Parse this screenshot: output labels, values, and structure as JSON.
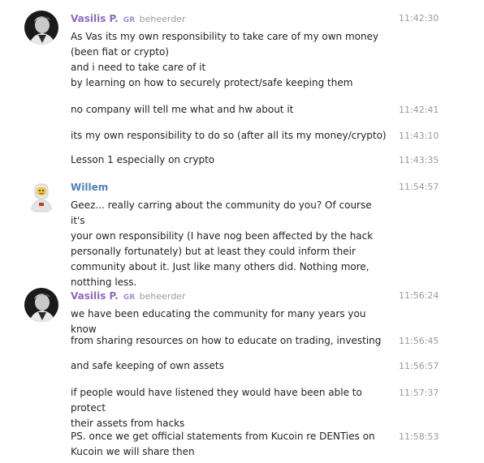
{
  "messages": [
    {
      "sender": "Vasilis P.",
      "tag": "GR",
      "role": "beheerder",
      "lines": [
        {
          "text": "As Vas its my own responsibility to take care of my own money\n(been fiat or crypto)\nand i need to take care of it\nby learning on how to securely protect/safe keeping them",
          "time": "11:42:30"
        },
        {
          "text": "no company will tell me what and hw about it",
          "time": "11:42:41"
        },
        {
          "text": "its my own responsibility to do so (after all its my money/crypto)",
          "time": "11:43:10"
        },
        {
          "text": "Lesson 1 especially on crypto",
          "time": "11:43:35"
        }
      ]
    },
    {
      "sender": "Willem",
      "lines": [
        {
          "text": "Geez... really carring about the community do you? Of course it's\nyour own responsibility (I have nog been affected by the hack\npersonally fortunately) but at least they could inform their\ncommunity about it. Just like many others did. Nothing more,\nnotthing less.",
          "time": "11:54:57"
        }
      ]
    },
    {
      "sender": "Vasilis P.",
      "tag": "GR",
      "role": "beheerder",
      "lines": [
        {
          "text": "we have been educating the community for many years you know",
          "time": "11:56:24"
        },
        {
          "text": "from sharing resources on how to educate on trading, investing",
          "time": "11:56:45"
        },
        {
          "text": "and safe keeping of own assets",
          "time": "11:56:57"
        },
        {
          "text": "if people would have listened they would have been able to protect\ntheir assets from hacks",
          "time": "11:57:37"
        },
        {
          "text": "PS. once we get official statements from Kucoin re DENTies on\nKucoin we will share then",
          "time": "11:58:53"
        }
      ]
    }
  ],
  "icons": {
    "avatar_vasilis": "avatar-photo",
    "avatar_willem": "lego-astronaut-avatar"
  }
}
